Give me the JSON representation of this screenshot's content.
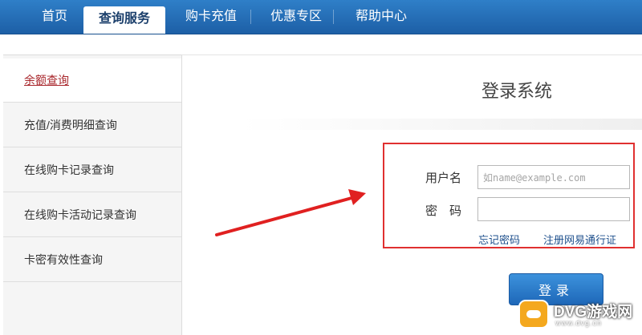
{
  "nav": {
    "items": [
      {
        "label": "首页"
      },
      {
        "label": "查询服务",
        "active": true
      },
      {
        "label": "购卡充值"
      },
      {
        "label": "优惠专区"
      },
      {
        "label": "帮助中心"
      }
    ]
  },
  "sidebar": {
    "items": [
      {
        "label": "余额查询",
        "active": true
      },
      {
        "label": "充值/消费明细查询"
      },
      {
        "label": "在线购卡记录查询"
      },
      {
        "label": "在线购卡活动记录查询"
      },
      {
        "label": "卡密有效性查询"
      }
    ]
  },
  "login": {
    "title": "登录系统",
    "username_label": "用户名",
    "username_placeholder": "如name@example.com",
    "password_label": "密　码",
    "forgot_link": "忘记密码",
    "register_link": "注册网易通行证",
    "submit_label": "登录"
  },
  "watermark": {
    "text": "DVG游戏网",
    "sub": "www.dvg.cn"
  },
  "colors": {
    "nav_blue": "#1d5fa6",
    "active_link": "#a8262b",
    "highlight_red": "#e03030",
    "button_blue": "#2a7ccb"
  }
}
